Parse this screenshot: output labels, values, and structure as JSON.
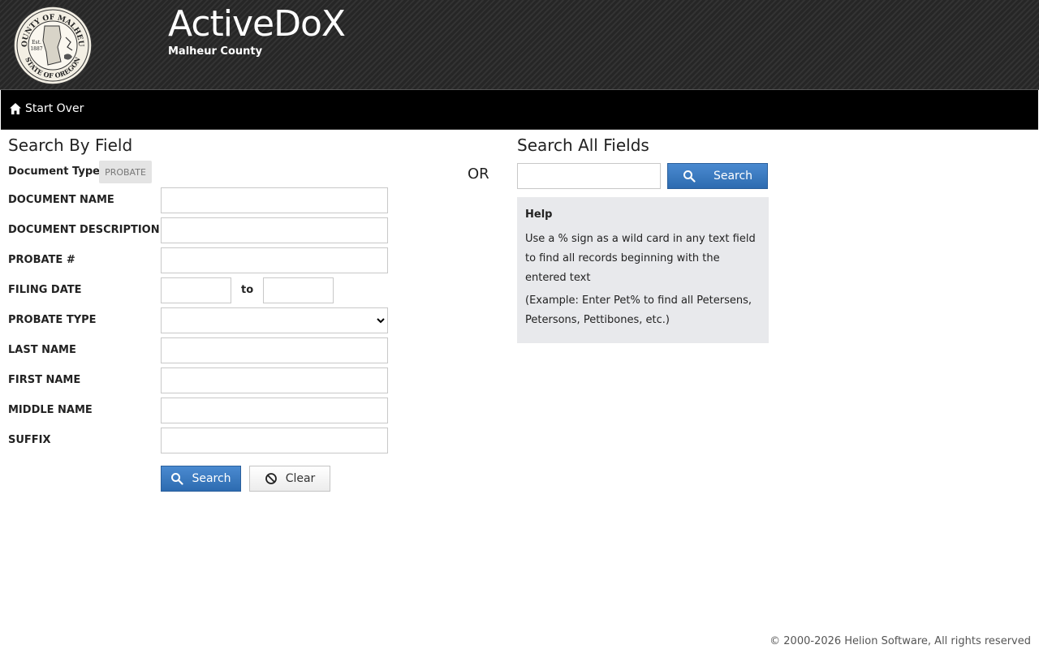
{
  "header": {
    "title": "ActiveDoX",
    "subtitle": "Malheur County",
    "seal": {
      "top_text": "COUNTY OF MALHEUR",
      "bottom_text": "STATE OF OREGON",
      "center_text_1": "Est.",
      "center_text_2": "1887"
    }
  },
  "nav": {
    "start_over_label": "Start Over",
    "icon": "home-icon"
  },
  "search_by_field": {
    "title": "Search By Field",
    "document_type_label": "Document Type:",
    "document_type_value": "PROBATE",
    "fields": {
      "document_name": "DOCUMENT NAME",
      "document_description": "DOCUMENT DESCRIPTION",
      "probate_number": "PROBATE #",
      "filing_date": "FILING DATE",
      "filing_date_to": "to",
      "probate_type": "PROBATE TYPE",
      "last_name": "LAST NAME",
      "first_name": "FIRST NAME",
      "middle_name": "MIDDLE NAME",
      "suffix": "SUFFIX"
    },
    "search_button": "Search",
    "clear_button": "Clear"
  },
  "or_label": "OR",
  "search_all_fields": {
    "title": "Search All Fields",
    "search_button": "Search",
    "help": {
      "title": "Help",
      "text_1": "Use a % sign as a wild card in any text field to find all records beginning with the entered text",
      "text_2": "(Example: Enter Pet% to find all Petersens, Petersons, Pettibones, etc.)"
    }
  },
  "footer": {
    "copyright": "© 2000-2026 Helion Software, All rights reserved"
  },
  "colors": {
    "primary_button": "#2d6bb0",
    "nav_background": "#000000",
    "help_background": "#e8e9ec"
  }
}
